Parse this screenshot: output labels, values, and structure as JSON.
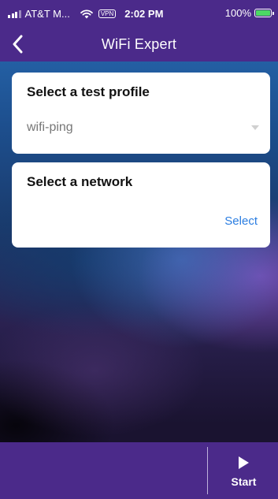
{
  "status_bar": {
    "carrier": "AT&T M...",
    "vpn_label": "VPN",
    "time": "2:02 PM",
    "battery_percent": "100%",
    "battery_level": 1.0,
    "battery_color": "#4cd964"
  },
  "nav": {
    "back_icon": "chevron-left-icon",
    "title": "WiFi Expert"
  },
  "profile_card": {
    "title": "Select a test profile",
    "selected_value": "wifi-ping",
    "dropdown_icon": "caret-down-icon"
  },
  "network_card": {
    "title": "Select a network",
    "select_label": "Select"
  },
  "bottom_bar": {
    "start_icon": "play-icon",
    "start_label": "Start"
  },
  "colors": {
    "header_bg": "#4b2a8a",
    "link": "#2a7de1",
    "card_bg": "#ffffff"
  }
}
